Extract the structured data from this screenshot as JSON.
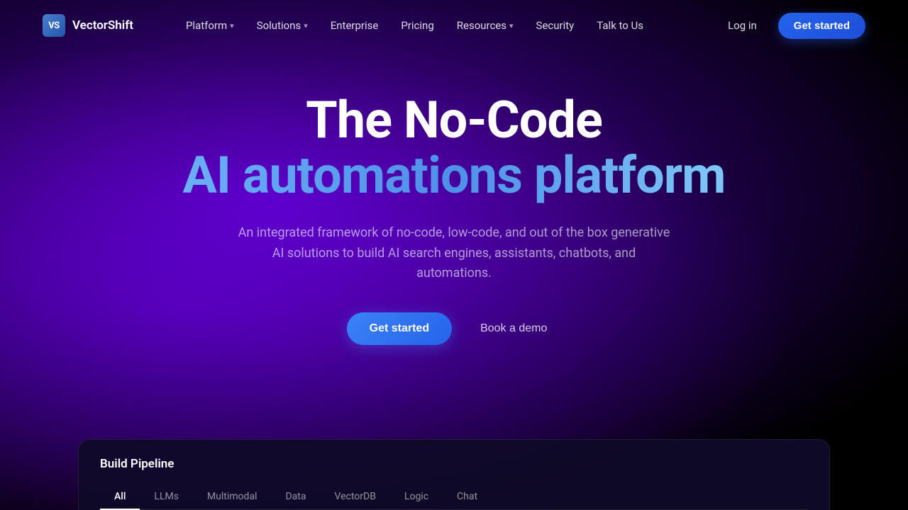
{
  "brand": {
    "logo_initials": "VS",
    "logo_name": "VectorShift"
  },
  "nav": {
    "items": [
      {
        "label": "Platform",
        "has_dropdown": true
      },
      {
        "label": "Solutions",
        "has_dropdown": true
      },
      {
        "label": "Enterprise",
        "has_dropdown": false
      },
      {
        "label": "Pricing",
        "has_dropdown": false
      },
      {
        "label": "Resources",
        "has_dropdown": true
      },
      {
        "label": "Security",
        "has_dropdown": false
      },
      {
        "label": "Talk to Us",
        "has_dropdown": false
      }
    ],
    "login_label": "Log in",
    "cta_label": "Get started"
  },
  "hero": {
    "title_line1": "The No-Code",
    "title_line2": "AI automations platform",
    "subtitle": "An integrated framework of no-code, low-code, and out of the box generative AI solutions to build AI search engines, assistants, chatbots, and automations.",
    "cta_primary": "Get started",
    "cta_secondary": "Book a demo"
  },
  "bottom_panel": {
    "title": "Build Pipeline",
    "tabs": [
      {
        "label": "All",
        "active": true
      },
      {
        "label": "LLMs",
        "active": false
      },
      {
        "label": "Multimodal",
        "active": false
      },
      {
        "label": "Data",
        "active": false
      },
      {
        "label": "VectorDB",
        "active": false
      },
      {
        "label": "Logic",
        "active": false
      },
      {
        "label": "Chat",
        "active": false
      }
    ]
  }
}
